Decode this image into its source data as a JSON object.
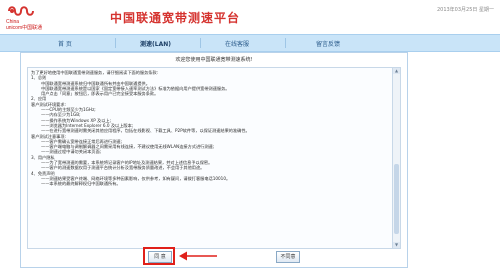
{
  "brand": {
    "name_en_line1": "China",
    "name_en_line2": "unicom中国联通",
    "logo_color": "#d5332f"
  },
  "header": {
    "title": "中国联通宽带测速平台",
    "info": "2013年03月25日 星期一"
  },
  "nav": {
    "items": [
      {
        "label": "首 页",
        "active": false
      },
      {
        "label": "测速(LAN)",
        "active": true
      },
      {
        "label": "在线客服",
        "active": false
      },
      {
        "label": "留言反馈",
        "active": false
      }
    ]
  },
  "dialog": {
    "title": "欢迎您使用中国联通宽带测速系统!",
    "terms": [
      {
        "text": "为了更好地使用中国联通宽带测速服务，请仔细阅读下面的服务条款:",
        "indent": false
      },
      {
        "text": "1、总则",
        "indent": false
      },
      {
        "text": "中国联通宽带测速系统归中国联通所有并由中国联通提供。",
        "indent": true
      },
      {
        "text": "中国联通宽带测速系统是以国家《固定宽带接入速率测试方法》标准为依据向用户提供宽带测速服务。",
        "indent": true
      },
      {
        "text": "用户点击「同意」按钮后，即表示用户已完全接受本服务条款。",
        "indent": true
      },
      {
        "text": "2、应用",
        "indent": false
      },
      {
        "text": "客户测试环境要求:",
        "indent": false
      },
      {
        "text": "——CPU的主频至少为1GHz;",
        "indent": true
      },
      {
        "text": "——内存至少为1GB;",
        "indent": true
      },
      {
        "text": "——操作系统为Windows XP 及以上;",
        "indent": true
      },
      {
        "text": "——浏览器为Internet Explorer 6.0 及以上版本;",
        "indent": true
      },
      {
        "text": "——在进行宽带测速时需关闭其他应用程序，包括在线影视、下载工具、P2P软件等，以保证测速结果的准确性。",
        "indent": true
      },
      {
        "text": "客户测试注意事项:",
        "indent": false
      },
      {
        "text": "——客户需确认宽带连接正常后再进行测速;",
        "indent": true
      },
      {
        "text": "——客户端电脑与调制解调器之间需采用有线连接，不建议使用无线WLAN连接方式进行测速;",
        "indent": true
      },
      {
        "text": "——测速过程中请勿关闭本页面;",
        "indent": true
      },
      {
        "text": "3、用户隐私",
        "indent": false
      },
      {
        "text": "——为了宽带测速的需要，本系统将记录客户的IP地址及测速结果，并对上述信息予以保密。",
        "indent": true
      },
      {
        "text": "——客户的测速数据仅用于测速平台统计分析及宽带服务质量改进，不会用于其他用途。",
        "indent": true
      },
      {
        "text": "4、免责声明",
        "indent": false
      },
      {
        "text": "——测速结果受客户终端、网络环境等多种因素影响，仅供参考，如有疑问，请拨打客服电话10010。",
        "indent": true
      },
      {
        "text": "——本系统的最终解释权归中国联通所有。",
        "indent": true
      }
    ],
    "agree_label": "同 意",
    "disagree_label": "不同意"
  },
  "accent": {
    "highlight": "#e0201a",
    "nav_bg": "#c9e4f8"
  }
}
